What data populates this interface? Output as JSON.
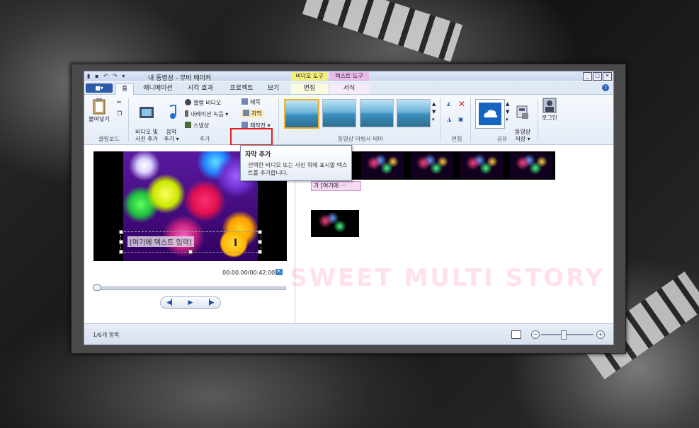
{
  "window": {
    "title": "내 동영상 - 무비 메이커",
    "context_tab_video": "비디오 도구",
    "context_tab_text": "텍스트 도구"
  },
  "tabs": {
    "file": "■▾",
    "home": "홈",
    "animation": "애니메이션",
    "visual_effects": "시각 효과",
    "project": "프로젝트",
    "view": "보기",
    "edit": "편집",
    "format": "서식"
  },
  "ribbon": {
    "paste": "붙여넣기",
    "clipboard_group": "클립보드",
    "add_video_photo": "비디오 및\n사진 추가",
    "add_music": "음악\n추가 ▾",
    "webcam_video": "웹캠 비디오",
    "record_narration": "내레이션 녹음",
    "snapshot": "스냅샷",
    "title": "제목",
    "caption": "자막",
    "credits": "제작진 ▾",
    "add_group": "추가",
    "automovie_group": "동영상 마법사 테마",
    "edit_group": "편집",
    "share_group": "공유",
    "save_movie": "동영상\n저장 ▾",
    "sign_in": "로그인"
  },
  "tooltip": {
    "title": "자막 추가",
    "body": "선택한 비디오 또는 사진 위에 표시할 텍스트를 추가합니다."
  },
  "preview": {
    "caption_text": "[여기에 텍스트 입력]",
    "time": "00:00.00/00:42.00",
    "prev": "◀▏",
    "play": "▶",
    "next": "▕▶"
  },
  "storyboard": {
    "caption_clip": "가 [여기에 ···",
    "watermark": "SWEET MULTI STORY"
  },
  "status": {
    "items": "1/6개 항목"
  }
}
